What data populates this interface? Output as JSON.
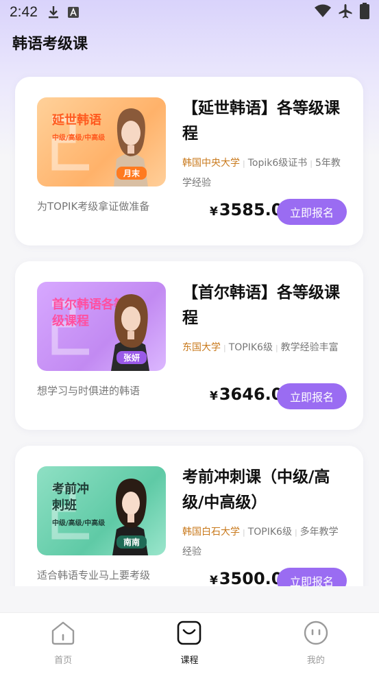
{
  "status_bar": {
    "time": "2:42",
    "icons": [
      "download-icon",
      "a-badge-icon",
      "wifi-icon",
      "airplane-icon",
      "battery-icon"
    ]
  },
  "page": {
    "title": "韩语考级课"
  },
  "colors": {
    "accent": "#9a6cf2",
    "school": "#c97a1d",
    "header_gradient": "#d9d3fb"
  },
  "courses": [
    {
      "thumb_title": "延世韩语",
      "thumb_sub": "中级/高级/中高级",
      "teacher": "月末",
      "title": "【延世韩语】各等级课程",
      "school": "韩国中央大学",
      "tag1": "Topik6级证书",
      "tag2": "5年教学经验",
      "subtitle": "为TOPIK考级拿证做准备",
      "currency": "¥",
      "price": "3585.0",
      "button": "立即报名"
    },
    {
      "thumb_title": "首尔韩语各等级课程",
      "thumb_sub": "",
      "teacher": "张妍",
      "title": "【首尔韩语】各等级课程",
      "school": "东国大学",
      "tag1": "TOPIK6级",
      "tag2": "教学经验丰富",
      "subtitle": "想学习与时俱进的韩语",
      "currency": "¥",
      "price": "3646.0",
      "button": "立即报名"
    },
    {
      "thumb_title": "考前冲刺班",
      "thumb_sub": "中级/高级/中高级",
      "teacher": "南南",
      "title": "考前冲刺课（中级/高级/中高级）",
      "school": "韩国白石大学",
      "tag1": "TOPIK6级",
      "tag2": "多年教学经验",
      "subtitle": "适合韩语专业马上要考级",
      "currency": "¥",
      "price": "3500.0",
      "button": "立即报名"
    }
  ],
  "tabbar": {
    "items": [
      {
        "label": "首页",
        "icon": "home-icon",
        "active": false
      },
      {
        "label": "课程",
        "icon": "course-icon",
        "active": true
      },
      {
        "label": "我的",
        "icon": "profile-face-icon",
        "active": false
      }
    ]
  }
}
